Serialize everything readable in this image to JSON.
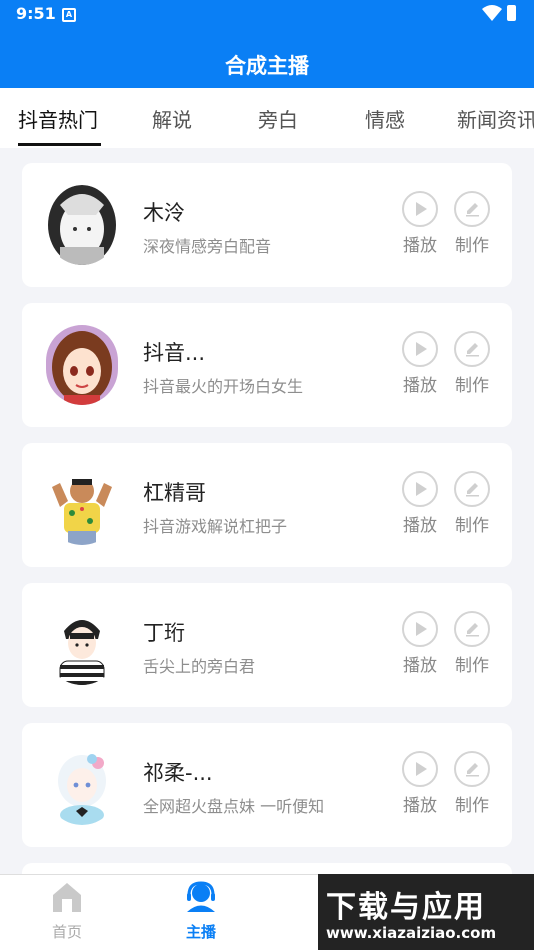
{
  "status": {
    "time": "9:51"
  },
  "header": {
    "title": "合成主播"
  },
  "tabs": [
    {
      "label": "抖音热门",
      "active": true
    },
    {
      "label": "解说"
    },
    {
      "label": "旁白"
    },
    {
      "label": "情感"
    },
    {
      "label": "新闻资讯"
    }
  ],
  "cards": [
    {
      "name": "木泠",
      "desc": "深夜情感旁白配音",
      "play": "播放",
      "edit": "制作"
    },
    {
      "name": "抖音...",
      "desc": "抖音最火的开场白女生",
      "play": "播放",
      "edit": "制作"
    },
    {
      "name": "杠精哥",
      "desc": "抖音游戏解说杠把子",
      "play": "播放",
      "edit": "制作"
    },
    {
      "name": "丁珩",
      "desc": "舌尖上的旁白君",
      "play": "播放",
      "edit": "制作"
    },
    {
      "name": "祁柔-...",
      "desc": "全网超火盘点妹 一听便知",
      "play": "播放",
      "edit": "制作"
    }
  ],
  "nav": {
    "home": "首页",
    "anchor": "主播"
  },
  "watermark": {
    "title": "下载与应用",
    "url": "www.xiazaiziao.com"
  },
  "colors": {
    "brand": "#0a7ff5"
  }
}
